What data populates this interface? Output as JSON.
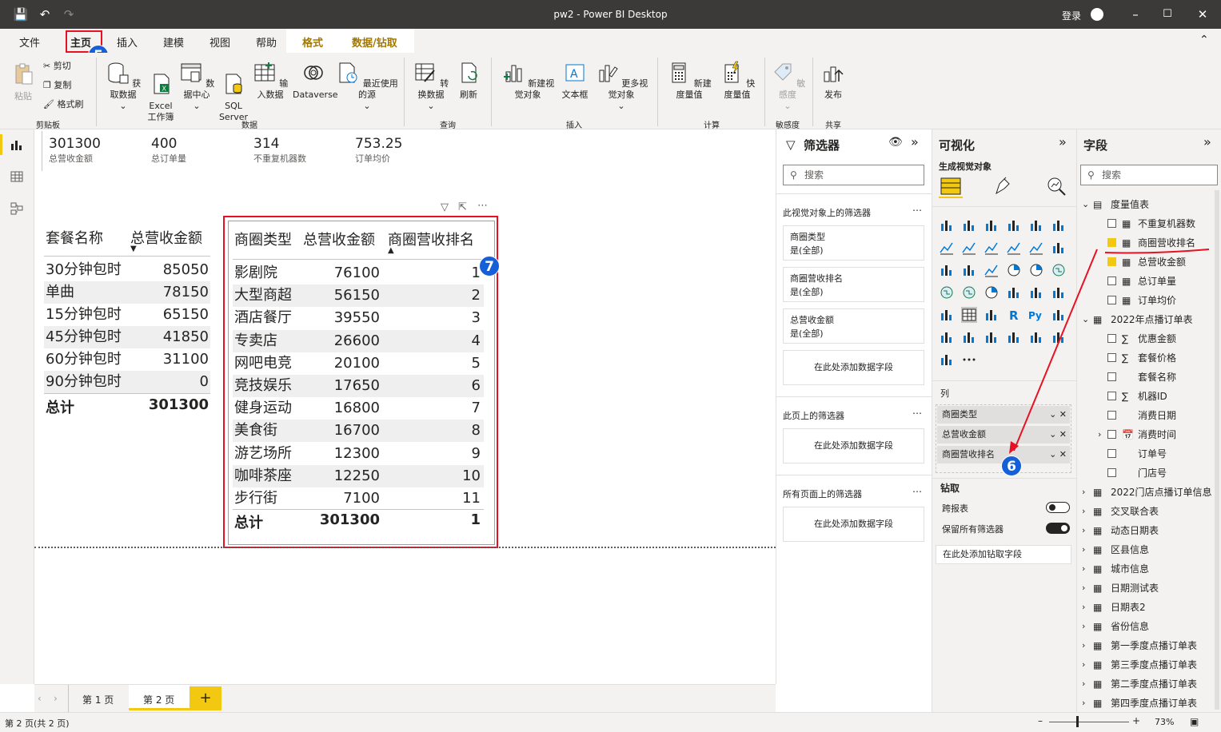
{
  "window": {
    "title": "pw2 - Power BI Desktop",
    "login": "登录"
  },
  "menu": [
    "文件",
    "主页",
    "插入",
    "建模",
    "视图",
    "帮助",
    "格式",
    "数据/钻取"
  ],
  "ribbon": {
    "paste": "粘贴",
    "cut": "剪切",
    "copy": "复制",
    "format_painter": "格式刷",
    "get_data": "获取数据",
    "excel": "Excel\n工作簿",
    "data_hub": "数据中心",
    "sql": "SQL\nServer",
    "enter_data": "输入数据",
    "dataverse": "Dataverse",
    "recent": "最近使用的源",
    "transform": "转换数据",
    "refresh": "刷新",
    "new_visual": "新建视觉对象",
    "textbox": "文本框",
    "more_visuals": "更多视觉对象",
    "new_measure": "新建度量值",
    "quick_measure": "快度量值",
    "sensitivity": "敏感度",
    "publish": "发布",
    "groups": {
      "clipboard": "剪贴板",
      "data": "数据",
      "query": "查询",
      "insert": "插入",
      "calc": "计算",
      "sensitivity": "敏感度",
      "share": "共享"
    }
  },
  "cards": [
    {
      "value": "301300",
      "label": "总营收金额"
    },
    {
      "value": "400",
      "label": "总订单量"
    },
    {
      "value": "314",
      "label": "不重复机器数"
    },
    {
      "value": "753.25",
      "label": "订单均价"
    }
  ],
  "table1": {
    "headers": [
      "套餐名称",
      "总营收金额"
    ],
    "rows": [
      [
        "30分钟包时",
        "85050"
      ],
      [
        "单曲",
        "78150"
      ],
      [
        "15分钟包时",
        "65150"
      ],
      [
        "45分钟包时",
        "41850"
      ],
      [
        "60分钟包时",
        "31100"
      ],
      [
        "90分钟包时",
        "0"
      ]
    ],
    "total": [
      "总计",
      "301300"
    ]
  },
  "table2": {
    "headers": [
      "商圈类型",
      "总营收金额",
      "商圈营收排名"
    ],
    "rows": [
      [
        "影剧院",
        "76100",
        "1"
      ],
      [
        "大型商超",
        "56150",
        "2"
      ],
      [
        "酒店餐厅",
        "39550",
        "3"
      ],
      [
        "专卖店",
        "26600",
        "4"
      ],
      [
        "网吧电竞",
        "20100",
        "5"
      ],
      [
        "竞技娱乐",
        "17650",
        "6"
      ],
      [
        "健身运动",
        "16800",
        "7"
      ],
      [
        "美食街",
        "16700",
        "8"
      ],
      [
        "游艺场所",
        "12300",
        "9"
      ],
      [
        "咖啡茶座",
        "12250",
        "10"
      ],
      [
        "步行街",
        "7100",
        "11"
      ]
    ],
    "total": [
      "总计",
      "301300",
      "1"
    ]
  },
  "badges": {
    "b5": "5",
    "b6": "6",
    "b7": "7"
  },
  "filters": {
    "title": "筛选器",
    "search": "搜索",
    "visual_section": "此视觉对象上的筛选器",
    "cards": [
      {
        "name": "商圈类型",
        "state": "是(全部)"
      },
      {
        "name": "商圈营收排名",
        "state": "是(全部)"
      },
      {
        "name": "总营收金额",
        "state": "是(全部)"
      }
    ],
    "add": "在此处添加数据字段",
    "page_section": "此页上的筛选器",
    "all_section": "所有页面上的筛选器"
  },
  "viz": {
    "title": "可视化",
    "subtitle": "生成视觉对象",
    "columns_label": "列",
    "wells": [
      "商圈类型",
      "总营收金额",
      "商圈营收排名"
    ],
    "drill": "钻取",
    "cross_report": "跨报表",
    "keep_filters": "保留所有筛选器",
    "add_drill": "在此处添加钻取字段"
  },
  "fields": {
    "title": "字段",
    "search": "搜索",
    "measures_table": "度量值表",
    "measures": [
      {
        "name": "不重复机器数",
        "checked": false
      },
      {
        "name": "商圈营收排名",
        "checked": true
      },
      {
        "name": "总营收金额",
        "checked": true
      },
      {
        "name": "总订单量",
        "checked": false
      },
      {
        "name": "订单均价",
        "checked": false
      }
    ],
    "order_table": "2022年点播订单表",
    "order_fields": [
      "优惠金额",
      "套餐价格",
      "套餐名称",
      "机器ID",
      "消费日期",
      "消费时间",
      "订单号",
      "门店号"
    ],
    "tables": [
      "2022门店点播订单信息",
      "交叉联合表",
      "动态日期表",
      "区县信息",
      "城市信息",
      "日期测试表",
      "日期表2",
      "省份信息",
      "第一季度点播订单表",
      "第三季度点播订单表",
      "第二季度点播订单表",
      "第四季度点播订单表"
    ]
  },
  "pages": [
    "第 1 页",
    "第 2 页"
  ],
  "status": {
    "page": "第 2 页(共 2 页)",
    "zoom": "73%"
  }
}
